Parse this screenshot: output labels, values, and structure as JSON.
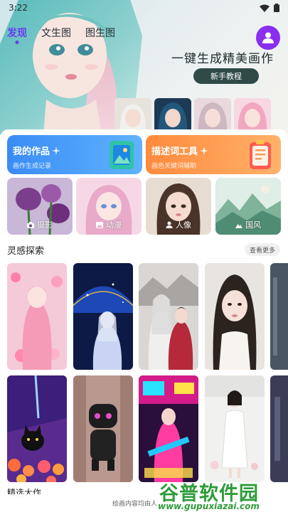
{
  "status": {
    "time": "3:22",
    "wifi_icon": "wifi-icon",
    "battery_icon": "battery-icon"
  },
  "header": {
    "tabs": [
      {
        "label": "发现",
        "active": true
      },
      {
        "label": "文生图",
        "active": false
      },
      {
        "label": "图生图",
        "active": false
      }
    ],
    "avatar_icon": "user-icon",
    "slogan": "一键生成精美画作",
    "tutorial_button": "新手教程"
  },
  "features": {
    "works": {
      "title": "我的作品",
      "subtitle": "画作生成记录",
      "icon": "gallery-icon"
    },
    "prompt": {
      "title": "描述词工具",
      "subtitle": "画色关键词辅助",
      "icon": "notepad-icon"
    }
  },
  "categories": [
    {
      "label": "摄影",
      "icon": "camera-icon"
    },
    {
      "label": "动漫",
      "icon": "image-icon"
    },
    {
      "label": "人像",
      "icon": "person-icon"
    },
    {
      "label": "国风",
      "icon": "mountain-icon"
    }
  ],
  "inspiration": {
    "title": "灵感探索",
    "more": "查看更多"
  },
  "section2_title": "精选大作",
  "bottom_note": "绘画内容均由人",
  "watermark": {
    "main": "谷普软件园",
    "url": "www.gupuxiazai.com"
  },
  "colors": {
    "accent": "#6a3cf0",
    "works_card": "#3a8cf5",
    "prompt_card": "#ff8a3d",
    "watermark": "#2e9c3a"
  }
}
